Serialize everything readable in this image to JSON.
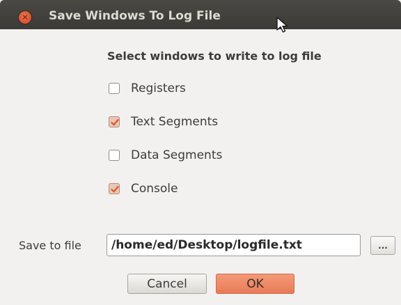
{
  "window": {
    "title": "Save Windows To Log File",
    "close_glyph": "×",
    "close_icon": "close-icon"
  },
  "heading": "Select windows to write to log file",
  "checkboxes": [
    {
      "label": "Registers",
      "checked": false
    },
    {
      "label": "Text Segments",
      "checked": true
    },
    {
      "label": "Data Segments",
      "checked": false
    },
    {
      "label": "Console",
      "checked": true
    }
  ],
  "save_to_file": {
    "label": "Save to file",
    "value": "/home/ed/Desktop/logfile.txt",
    "browse_label": "..."
  },
  "buttons": {
    "cancel_label": "Cancel",
    "ok_label": "OK"
  },
  "colors": {
    "titlebar": "#3c3b37",
    "accent": "#ef8159",
    "checked_fill": "#e9c7b8",
    "checkmark": "#e05a2b"
  }
}
